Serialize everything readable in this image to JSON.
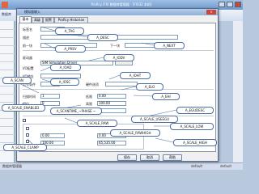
{
  "window": {
    "title": "Proficy iFIX 数据库管理器 - [FIX32 本机]"
  },
  "toolbar": {
    "label": "数据库"
  },
  "status_bar": {
    "text": "数据库管理器",
    "cells": [
      "default",
      "default"
    ]
  },
  "dialog": {
    "title": "模拟量输入",
    "close_label": "×",
    "tabs": [
      "基本",
      "高级",
      "报警",
      "Proficy Historian"
    ],
    "fields": {
      "tag_label": "标签名",
      "desc_label": "描述",
      "prev_label": "前一块",
      "next_label": "下一块",
      "driver_label": "驱动器",
      "driver_value": "SIM    Simulation Driver",
      "io_config_label": "I/O配置",
      "io_address_label": "I/O地址",
      "signal_label": "信号条件",
      "hardware_label": "硬件选项",
      "scan_label": "扫描时间",
      "scan_value": "1",
      "phase_label": "相位",
      "phase_value": "0",
      "low_label": "低限",
      "low_value": "0.00",
      "high_label": "高限",
      "high_value": "100.00",
      "units_label": "单位",
      "scale_low_value": "0.00",
      "scale_high_value": "65,535.00",
      "raw_low_value": "0.00",
      "raw_high_value": "100.00"
    },
    "buttons": {
      "save": "保存",
      "cancel": "取消",
      "help": "帮助"
    }
  },
  "callouts": {
    "tag": "A_TAG",
    "desc": "A_DESC",
    "next": "A_NEXT",
    "prev": "A_PREV",
    "iodv": "A_IODV",
    "ioad": "A_IOAD",
    "ioht": "A_IOHT",
    "iosc": "A_IOSC",
    "scan": "A_SCAN",
    "elo": "A_ELO",
    "ehi": "A_EHI",
    "scale_enabled": "A_SCALE_ENABLED",
    "scantime": "A_SCANTIME_~PHASE ~",
    "egudesc": "A_EGUDESC",
    "scale_raw": "A_SCALE_RAW",
    "scale_useegu": "A_SCALE_USEEGU",
    "scale_low": "A_SCALE_LOW",
    "scale_rawhigh": "A_SCALE_RAWHIGH",
    "scale_clamp": "A_SCALE_CLAMP",
    "scale_high": "A_SCALE_HIGH"
  }
}
